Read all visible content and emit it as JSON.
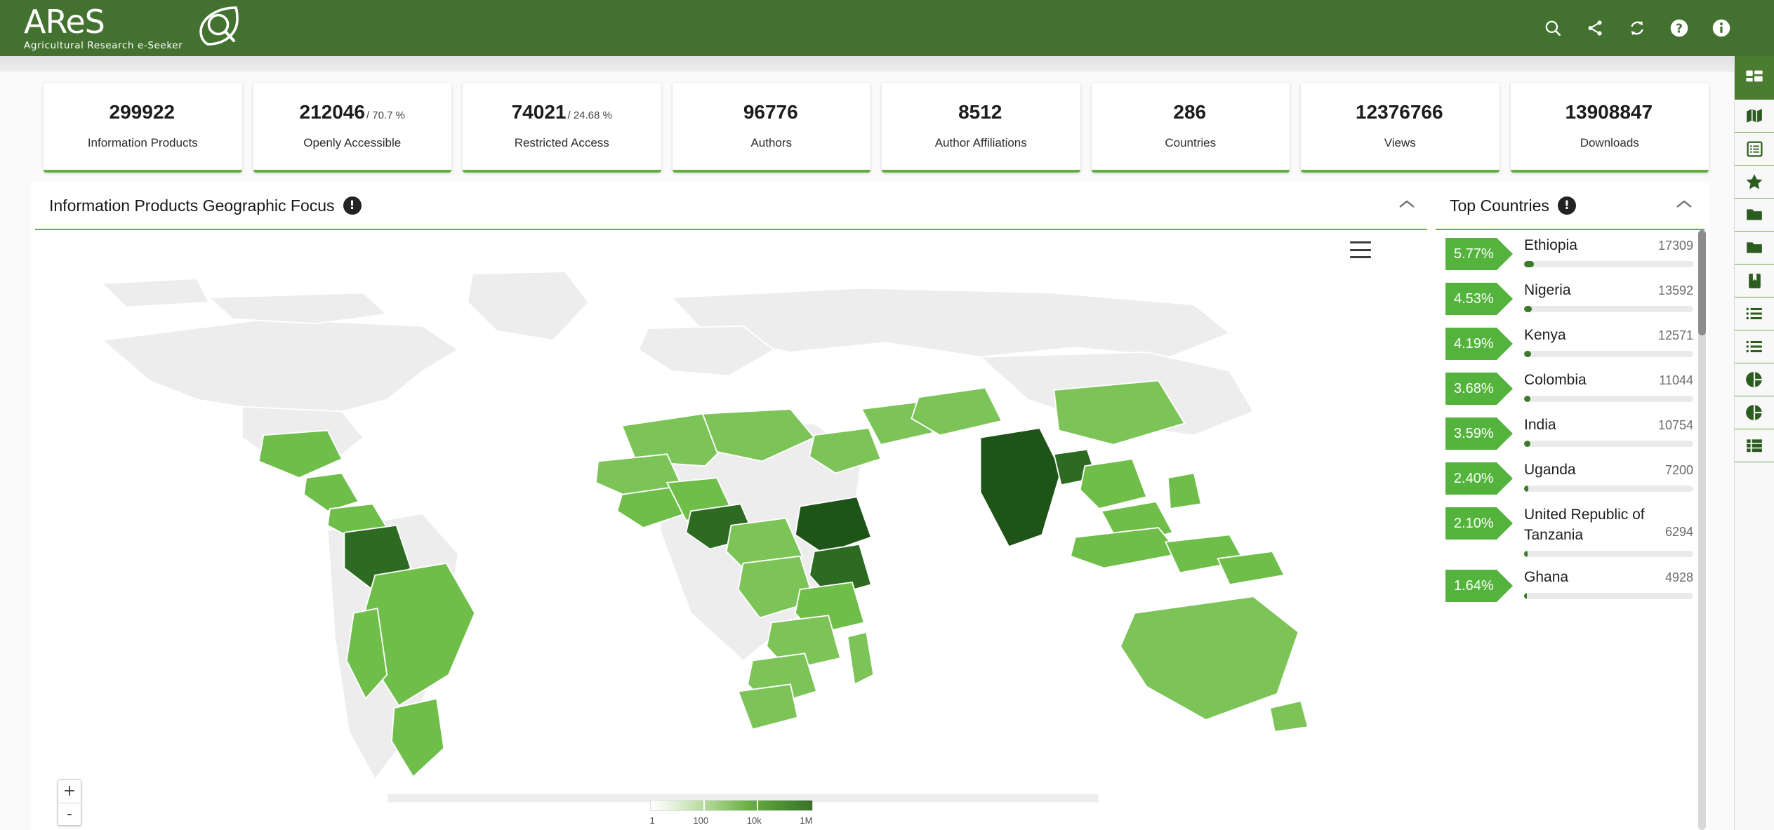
{
  "header": {
    "logo_main": "AReS",
    "logo_sub": "Agricultural Research e-Seeker",
    "actions": [
      {
        "name": "search-icon",
        "label": "Search"
      },
      {
        "name": "share-icon",
        "label": "Share"
      },
      {
        "name": "refresh-icon",
        "label": "Refresh"
      },
      {
        "name": "help-icon",
        "label": "Help"
      },
      {
        "name": "info-icon",
        "label": "Information"
      }
    ],
    "brand_color": "#437230"
  },
  "stats": [
    {
      "value": "299922",
      "pct": "",
      "label": "Information Products"
    },
    {
      "value": "212046",
      "pct": "/ 70.7 %",
      "label": "Openly Accessible"
    },
    {
      "value": "74021",
      "pct": "/ 24.68 %",
      "label": "Restricted Access"
    },
    {
      "value": "96776",
      "pct": "",
      "label": "Authors"
    },
    {
      "value": "8512",
      "pct": "",
      "label": "Author Affiliations"
    },
    {
      "value": "286",
      "pct": "",
      "label": "Countries"
    },
    {
      "value": "12376766",
      "pct": "",
      "label": "Views"
    },
    {
      "value": "13908847",
      "pct": "",
      "label": "Downloads"
    }
  ],
  "map_panel": {
    "title": "Information Products Geographic Focus",
    "alert_badge": "!",
    "menu_icon": "hamburger-menu-icon",
    "zoom_in": "+",
    "zoom_out": "-",
    "legend": {
      "ticks": [
        "1",
        "100",
        "10k",
        "1M"
      ],
      "low_color": "#ffffff",
      "high_color": "#3b7327"
    }
  },
  "countries_panel": {
    "title": "Top Countries",
    "alert_badge": "!",
    "rows": [
      {
        "pct": "5.77%",
        "name": "Ethiopia",
        "count": "17309",
        "bar": 5.77
      },
      {
        "pct": "4.53%",
        "name": "Nigeria",
        "count": "13592",
        "bar": 4.53
      },
      {
        "pct": "4.19%",
        "name": "Kenya",
        "count": "12571",
        "bar": 4.19
      },
      {
        "pct": "3.68%",
        "name": "Colombia",
        "count": "11044",
        "bar": 3.68
      },
      {
        "pct": "3.59%",
        "name": "India",
        "count": "10754",
        "bar": 3.59
      },
      {
        "pct": "2.40%",
        "name": "Uganda",
        "count": "7200",
        "bar": 2.4
      },
      {
        "pct": "2.10%",
        "name": "United Republic of Tanzania",
        "count": "6294",
        "bar": 2.1
      },
      {
        "pct": "1.64%",
        "name": "Ghana",
        "count": "4928",
        "bar": 1.64
      }
    ]
  },
  "rail": [
    {
      "name": "dashboard-icon",
      "label": "Dashboard",
      "active": true
    },
    {
      "name": "map-icon",
      "label": "Map",
      "active": false
    },
    {
      "name": "list-box-icon",
      "label": "List",
      "active": false
    },
    {
      "name": "star-icon",
      "label": "Favorites",
      "active": false
    },
    {
      "name": "folder-icon",
      "label": "Folder",
      "active": false
    },
    {
      "name": "folder-icon-2",
      "label": "Folder",
      "active": false
    },
    {
      "name": "bookmark-icon",
      "label": "Bookmark",
      "active": false
    },
    {
      "name": "bullet-list-icon",
      "label": "Bullet list",
      "active": false
    },
    {
      "name": "bullet-list-icon-2",
      "label": "Bullet list",
      "active": false
    },
    {
      "name": "pie-chart-icon",
      "label": "Pie chart",
      "active": false
    },
    {
      "name": "pie-chart-icon-2",
      "label": "Pie chart",
      "active": false
    },
    {
      "name": "table-icon",
      "label": "Table",
      "active": false
    }
  ],
  "chart_data": {
    "type": "bar",
    "title": "Top Countries",
    "categories": [
      "Ethiopia",
      "Nigeria",
      "Kenya",
      "Colombia",
      "India",
      "Uganda",
      "United Republic of Tanzania",
      "Ghana"
    ],
    "values": [
      17309,
      13592,
      12571,
      11044,
      10754,
      7200,
      6294,
      4928
    ],
    "percentages": [
      5.77,
      4.53,
      4.19,
      3.68,
      3.59,
      2.4,
      2.1,
      1.64
    ],
    "xlabel": "",
    "ylabel": "Information Products",
    "legend": "none"
  },
  "map_data": {
    "type": "choropleth",
    "title": "Information Products Geographic Focus",
    "scale": "logarithmic",
    "scale_ticks": [
      1,
      100,
      10000,
      1000000
    ],
    "highlighted": {
      "dark": [
        "India",
        "Ethiopia",
        "Colombia",
        "Kenya",
        "Nigeria"
      ],
      "mid": [
        "Mexico",
        "Brazil",
        "Peru",
        "Australia",
        "Indonesia",
        "Ghana",
        "Uganda",
        "Tanzania",
        "Bangladesh",
        "Vietnam",
        "China",
        "Mali",
        "Niger",
        "Burkina Faso"
      ]
    }
  }
}
